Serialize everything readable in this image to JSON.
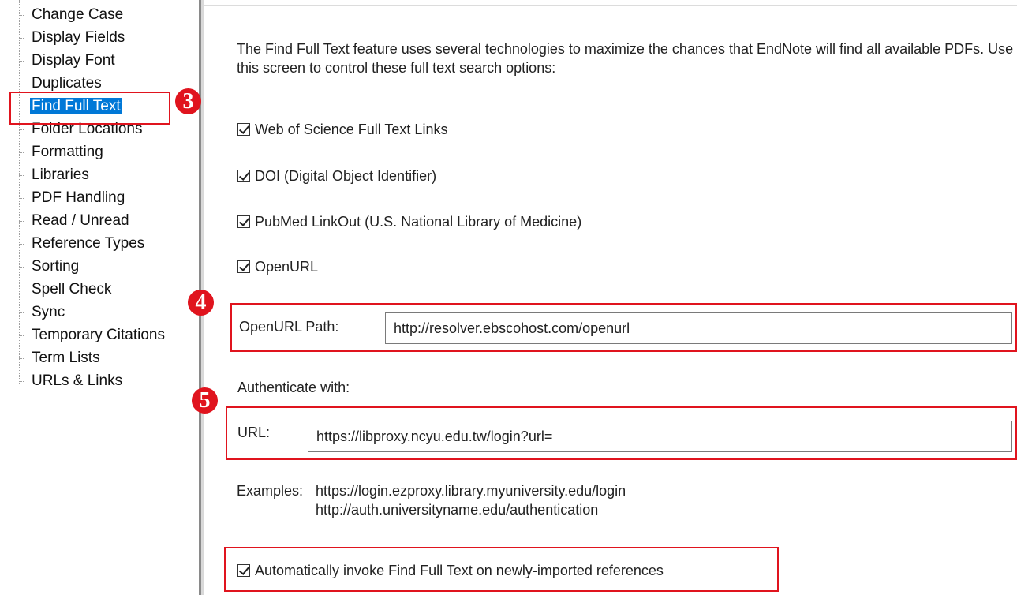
{
  "tree": {
    "items": [
      {
        "label": "Change Case"
      },
      {
        "label": "Display Fields"
      },
      {
        "label": "Display Font"
      },
      {
        "label": "Duplicates"
      },
      {
        "label": "Find Full Text",
        "selected": true
      },
      {
        "label": "Folder Locations"
      },
      {
        "label": "Formatting"
      },
      {
        "label": "Libraries"
      },
      {
        "label": "PDF Handling"
      },
      {
        "label": "Read / Unread"
      },
      {
        "label": "Reference Types"
      },
      {
        "label": "Sorting"
      },
      {
        "label": "Spell Check"
      },
      {
        "label": "Sync"
      },
      {
        "label": "Temporary Citations"
      },
      {
        "label": "Term Lists"
      },
      {
        "label": "URLs & Links"
      }
    ]
  },
  "panel": {
    "intro": "The Find Full Text feature uses several technologies to maximize the chances that EndNote will find all available PDFs. Use this screen to control these full text search options:",
    "options": [
      {
        "label": "Web of Science Full Text Links",
        "checked": true
      },
      {
        "label": "DOI (Digital Object Identifier)",
        "checked": true
      },
      {
        "label": "PubMed LinkOut (U.S. National Library of Medicine)",
        "checked": true
      },
      {
        "label": "OpenURL",
        "checked": true
      }
    ],
    "openurl_label": "OpenURL Path:",
    "openurl_value": "http://resolver.ebscohost.com/openurl",
    "auth_label": "Authenticate with:",
    "url_label": "URL:",
    "url_value": "https://libproxy.ncyu.edu.tw/login?url=",
    "examples_label": "Examples:",
    "examples": [
      "https://login.ezproxy.library.myuniversity.edu/login",
      "http://auth.universityname.edu/authentication"
    ],
    "auto_invoke_label": "Automatically invoke Find Full Text on newly-imported references",
    "auto_invoke_checked": true
  },
  "annotations": {
    "color": "#e0141e",
    "badges": [
      "3",
      "4",
      "5"
    ]
  }
}
